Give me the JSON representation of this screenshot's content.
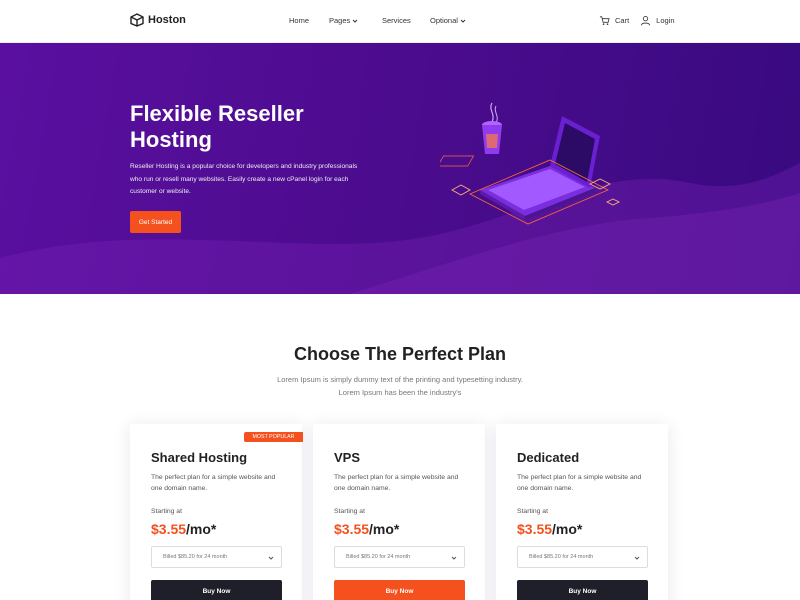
{
  "header": {
    "brand": "Hoston",
    "nav": [
      {
        "label": "Home",
        "dropdown": false
      },
      {
        "label": "Pages",
        "dropdown": true
      },
      {
        "label": "Services",
        "dropdown": false
      },
      {
        "label": "Optional",
        "dropdown": true
      }
    ],
    "cart_label": "Cart",
    "login_label": "Login"
  },
  "hero": {
    "title": "Flexible Reseller Hosting",
    "description": "Reseller Hosting is a popular choice for developers and industry professionals who run or resell many websites. Easily create a new cPanel login for each customer or website.",
    "cta_label": "Get Started"
  },
  "plans": {
    "title": "Choose The Perfect Plan",
    "subtitle": "Lorem Ipsum is simply dummy text of the printing and typesetting industry. Lorem Ipsum has been the industry's",
    "cards": [
      {
        "name": "Shared Hosting",
        "badge": "MOST POPULAR",
        "desc": "The perfect plan for a simple website and one domain name.",
        "starting": "Starting at",
        "price": "$3.55",
        "period": "/mo*",
        "billing": "Billed $85.20 for 24 month",
        "button": "Buy Now"
      },
      {
        "name": "VPS",
        "desc": "The perfect plan for a simple website and one domain name.",
        "starting": "Starting at",
        "price": "$3.55",
        "period": "/mo*",
        "billing": "Billed $85.20 for 24 month",
        "button": "Buy Now"
      },
      {
        "name": "Dedicated",
        "desc": "The perfect plan for a simple website and one domain name.",
        "starting": "Starting at",
        "price": "$3.55",
        "period": "/mo*",
        "billing": "Billed $85.20 for 24 month",
        "button": "Buy Now"
      }
    ]
  },
  "colors": {
    "accent": "#f4511e",
    "hero_purple": "#4d0c8f",
    "dark_button": "#1f1f2a"
  },
  "icons": [
    "logo-box-icon",
    "chevron-down-icon",
    "cart-icon",
    "user-icon"
  ]
}
